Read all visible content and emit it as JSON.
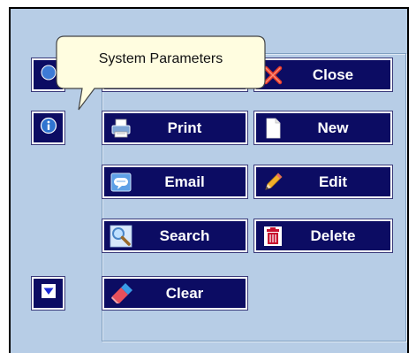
{
  "tooltip": {
    "text": "System Parameters"
  },
  "buttons": {
    "close": "Close",
    "print": "Print",
    "new": "New",
    "email": "Email",
    "edit": "Edit",
    "search": "Search",
    "delete": "Delete",
    "clear": "Clear"
  },
  "icons": {
    "system_parameters": "system-parameters-icon",
    "info": "info-icon",
    "scroll_down": "arrow-down-icon",
    "close": "close-x-icon",
    "print": "printer-icon",
    "new": "new-document-icon",
    "email": "email-icon",
    "edit": "pencil-icon",
    "search": "magnifier-icon",
    "delete": "trash-icon",
    "clear": "eraser-icon"
  },
  "colors": {
    "window_bg": "#b7cde6",
    "button_bg": "#0c0c63",
    "button_text": "#ffffff",
    "tooltip_bg": "#fffde0"
  }
}
